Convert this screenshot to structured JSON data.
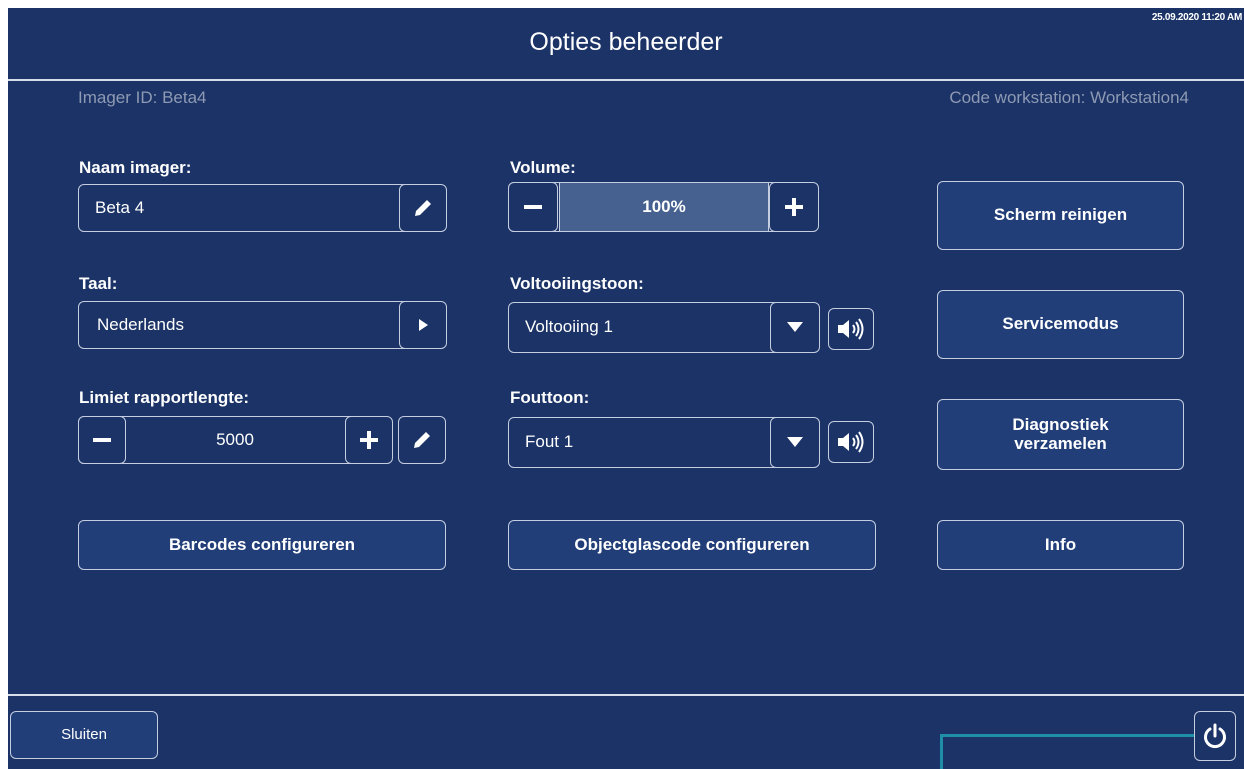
{
  "header": {
    "timestamp": "25.09.2020 11:20 AM",
    "title": "Opties beheerder"
  },
  "meta": {
    "imager_id": "Imager ID: Beta4",
    "workstation": "Code workstation: Workstation4"
  },
  "naam_imager": {
    "label": "Naam imager:",
    "value": "Beta 4",
    "edit_icon": "pencil-icon"
  },
  "taal": {
    "label": "Taal:",
    "value": "Nederlands",
    "icon": "play-arrow-icon"
  },
  "limiet": {
    "label": "Limiet rapportlengte:",
    "value": "5000",
    "minus_icon": "minus-icon",
    "plus_icon": "plus-icon",
    "edit_icon": "pencil-icon"
  },
  "volume": {
    "label": "Volume:",
    "value": "100%",
    "level": 1.0
  },
  "voltooiingstoon": {
    "label": "Voltooiingstoon:",
    "selected": "Voltooiing 1",
    "icon": "speaker-icon"
  },
  "fouttoon": {
    "label": "Fouttoon:",
    "selected": "Fout 1",
    "icon": "speaker-icon"
  },
  "buttons": {
    "scherm_reinigen": "Scherm reinigen",
    "servicemodus": "Servicemodus",
    "diagnostiek_line1": "Diagnostiek",
    "diagnostiek_line2": "verzamelen",
    "barcodes": "Barcodes configureren",
    "objectglas": "Objectglascode configureren",
    "info": "Info",
    "sluiten": "Sluiten"
  },
  "colors": {
    "background": "#1b3366",
    "border": "#c5cde0",
    "muted_text": "#8e9ab4",
    "callout_line": "#1f8fa8"
  },
  "power": {
    "icon": "power-icon"
  }
}
